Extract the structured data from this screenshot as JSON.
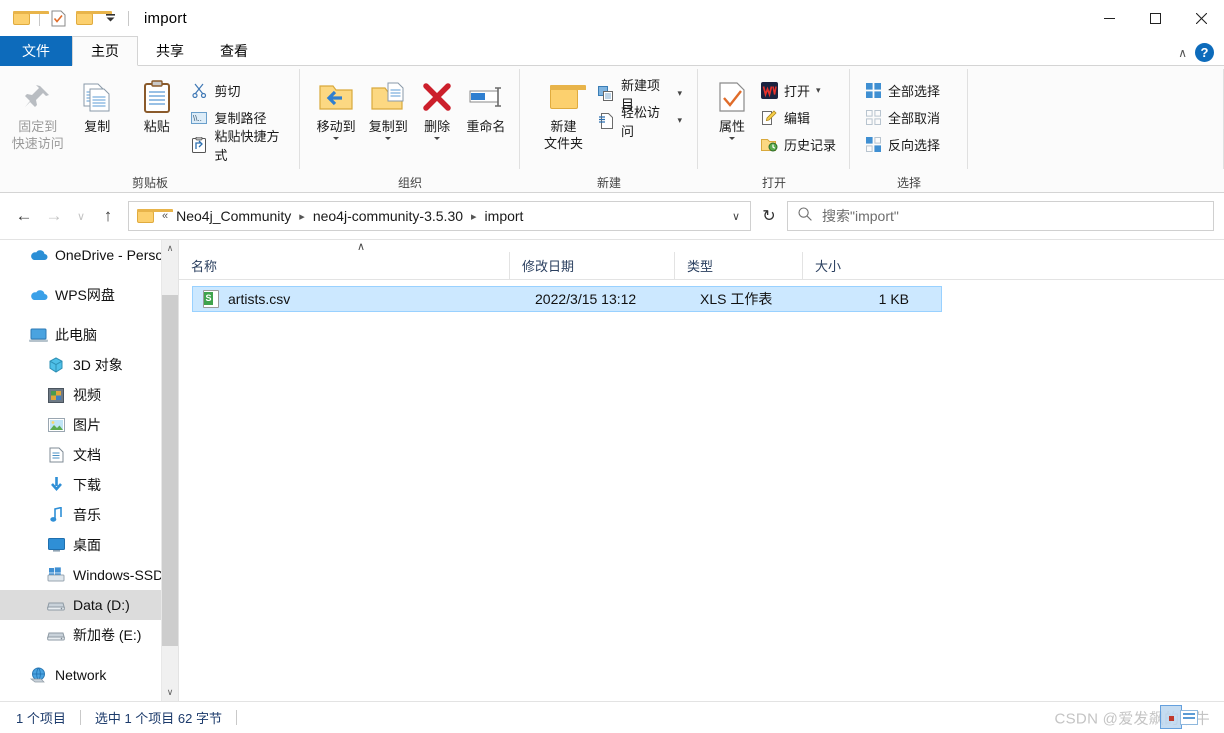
{
  "titlebar": {
    "title": "import",
    "quick_access": [
      "folder-icon",
      "properties-icon",
      "new-folder-icon",
      "customize-dropdown"
    ],
    "minimize": "—",
    "maximize": "□",
    "close": "✕"
  },
  "tabs": [
    {
      "label": "文件",
      "key": "file"
    },
    {
      "label": "主页",
      "key": "home"
    },
    {
      "label": "共享",
      "key": "share"
    },
    {
      "label": "查看",
      "key": "view"
    }
  ],
  "tabrow_right": {
    "collapse": "∧",
    "help": "?"
  },
  "ribbon": {
    "groups": [
      {
        "label": "剪贴板",
        "big": [
          {
            "label": "固定到\n快速访问",
            "line1": "固定到",
            "line2": "快速访问",
            "icon": "pin-icon",
            "disabled": true
          },
          {
            "label": "复制",
            "line1": "复制",
            "line2": "",
            "icon": "copy-icon",
            "disabled": false
          },
          {
            "label": "粘贴",
            "line1": "粘贴",
            "line2": "",
            "icon": "paste-icon",
            "disabled": false
          }
        ],
        "small": [
          {
            "label": "剪切",
            "icon": "scissors-icon"
          },
          {
            "label": "复制路径",
            "icon": "copy-path-icon"
          },
          {
            "label": "粘贴快捷方式",
            "icon": "paste-shortcut-icon"
          }
        ]
      },
      {
        "label": "组织",
        "big": [
          {
            "line1": "移动到",
            "line2": "",
            "icon": "move-to-icon",
            "caret": true
          },
          {
            "line1": "复制到",
            "line2": "",
            "icon": "copy-to-icon",
            "caret": true
          },
          {
            "line1": "删除",
            "line2": "",
            "icon": "delete-icon",
            "caret": true
          },
          {
            "line1": "重命名",
            "line2": "",
            "icon": "rename-icon",
            "caret": false
          }
        ],
        "small": []
      },
      {
        "label": "新建",
        "big": [
          {
            "line1": "新建",
            "line2": "文件夹",
            "icon": "new-folder-icon",
            "caret": false
          }
        ],
        "small": [
          {
            "label": "新建项目",
            "icon": "new-item-icon",
            "caret": true
          },
          {
            "label": "轻松访问",
            "icon": "easy-access-icon",
            "caret": true
          }
        ]
      },
      {
        "label": "打开",
        "big": [
          {
            "line1": "属性",
            "line2": "",
            "icon": "properties-icon",
            "caret": true
          }
        ],
        "small": [
          {
            "label": "打开",
            "icon": "wps-open-icon",
            "caret": true
          },
          {
            "label": "编辑",
            "icon": "edit-icon",
            "caret": false
          },
          {
            "label": "历史记录",
            "icon": "history-icon",
            "caret": false
          }
        ]
      },
      {
        "label": "选择",
        "big": [],
        "small": [
          {
            "label": "全部选择",
            "icon": "select-all-icon"
          },
          {
            "label": "全部取消",
            "icon": "select-none-icon"
          },
          {
            "label": "反向选择",
            "icon": "invert-selection-icon"
          }
        ]
      }
    ]
  },
  "addressbar": {
    "back": "←",
    "forward": "→",
    "recent": "∨",
    "up": "↑",
    "breadcrumb": [
      "Neo4j_Community",
      "neo4j-community-3.5.30",
      "import"
    ],
    "breadcrumb_prefix": "«",
    "dropdown": "∨",
    "refresh": "↻",
    "search_placeholder": "搜索\"import\"",
    "search_value": "",
    "search_icon": "search-icon"
  },
  "sidebar": {
    "items": [
      {
        "label": "OneDrive - Perso",
        "icon": "onedrive-icon",
        "indent": 0,
        "selected": false
      },
      {
        "label": "WPS网盘",
        "icon": "wps-cloud-icon",
        "indent": 0,
        "selected": false,
        "gap_before": true
      },
      {
        "label": "此电脑",
        "icon": "this-pc-icon",
        "indent": 0,
        "selected": false,
        "gap_before": true
      },
      {
        "label": "3D 对象",
        "icon": "3d-objects-icon",
        "indent": 1,
        "selected": false
      },
      {
        "label": "视频",
        "icon": "videos-icon",
        "indent": 1,
        "selected": false
      },
      {
        "label": "图片",
        "icon": "pictures-icon",
        "indent": 1,
        "selected": false
      },
      {
        "label": "文档",
        "icon": "documents-icon",
        "indent": 1,
        "selected": false
      },
      {
        "label": "下载",
        "icon": "downloads-icon",
        "indent": 1,
        "selected": false
      },
      {
        "label": "音乐",
        "icon": "music-icon",
        "indent": 1,
        "selected": false
      },
      {
        "label": "桌面",
        "icon": "desktop-icon",
        "indent": 1,
        "selected": false
      },
      {
        "label": "Windows-SSD (",
        "icon": "windows-drive-icon",
        "indent": 1,
        "selected": false
      },
      {
        "label": "Data (D:)",
        "icon": "drive-icon",
        "indent": 1,
        "selected": true
      },
      {
        "label": "新加卷 (E:)",
        "icon": "drive-icon",
        "indent": 1,
        "selected": false
      },
      {
        "label": "Network",
        "icon": "network-icon",
        "indent": 0,
        "selected": false,
        "gap_before": true
      }
    ],
    "scroll_up": "∧",
    "scroll_down": "∨"
  },
  "filelist": {
    "sort_indicator": "∧",
    "columns": [
      {
        "label": "名称",
        "key": "name"
      },
      {
        "label": "修改日期",
        "key": "date"
      },
      {
        "label": "类型",
        "key": "type"
      },
      {
        "label": "大小",
        "key": "size"
      }
    ],
    "rows": [
      {
        "name": "artists.csv",
        "date": "2022/3/15 13:12",
        "type": "XLS 工作表",
        "size": "1 KB",
        "icon": "csv-file-icon",
        "icon_letter": "S",
        "selected": true
      }
    ]
  },
  "status": {
    "item_count": "1 个项目",
    "selection": "选中 1 个项目  62 字节",
    "watermark": "CSDN @爱发飙的蜗牛"
  },
  "colors": {
    "accent": "#0d6bbb",
    "selection_bg": "#cce8ff",
    "selection_border": "#99d1ff",
    "sidebar_selected": "#dcdcdc",
    "ribbon_bg": "#fbfbfb",
    "status_text": "#1b3a6b"
  }
}
